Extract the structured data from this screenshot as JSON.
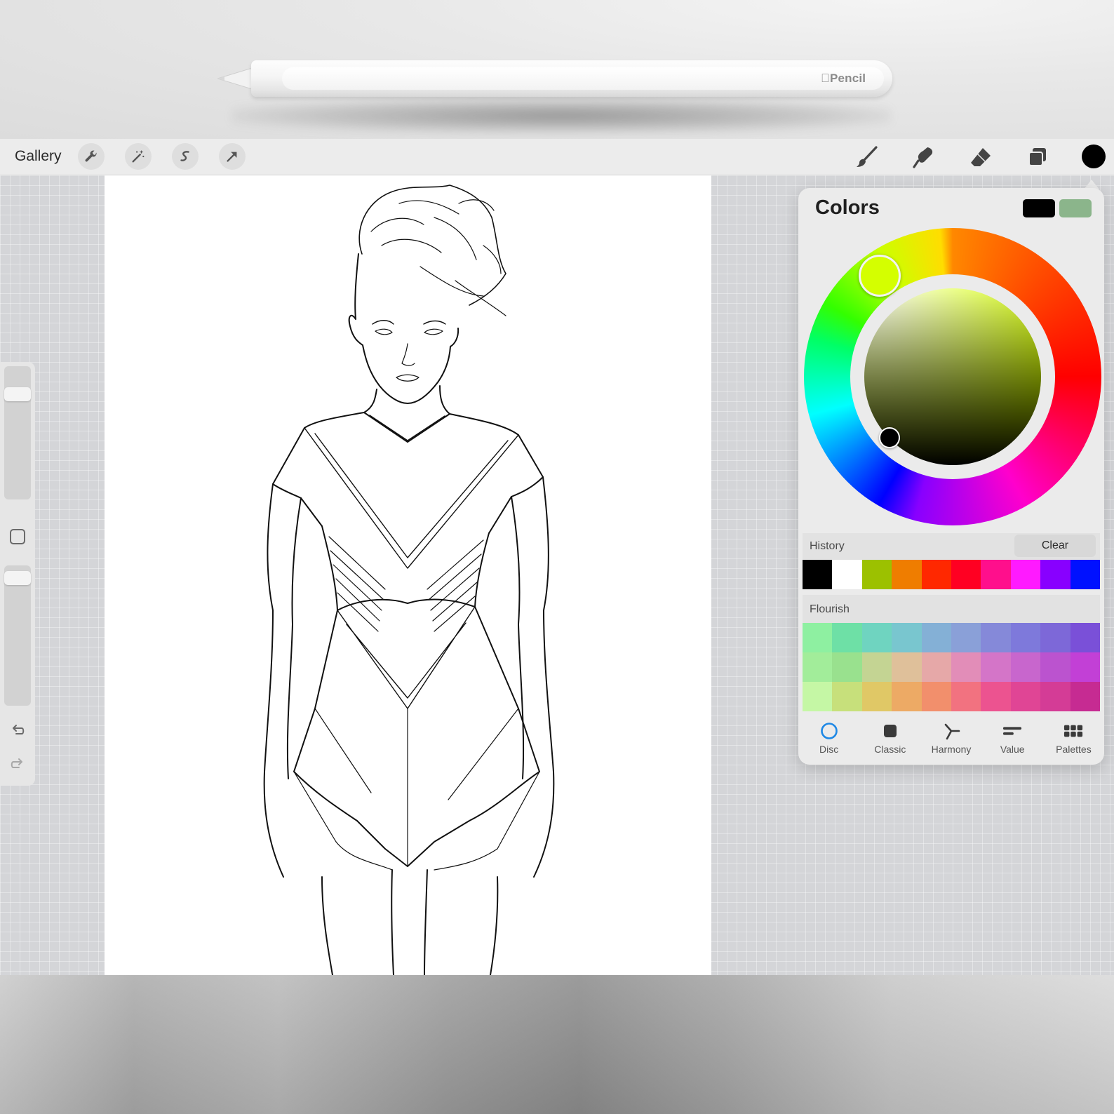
{
  "photo": {
    "pencil_brand": "Pencil"
  },
  "toolbar": {
    "gallery_label": "Gallery",
    "left_tools": [
      "wrench-icon",
      "magic-wand-icon",
      "selection-icon",
      "transform-arrow-icon"
    ],
    "right_tools": [
      "brush-icon",
      "smudge-icon",
      "eraser-icon",
      "layers-icon"
    ],
    "active_color": "#000000"
  },
  "sidebar": {
    "brush_size_level": 0.05,
    "opacity_level": 0.05,
    "modify_icon": "square-icon",
    "undo_icon": "undo-icon",
    "redo_icon": "redo-icon"
  },
  "colors_panel": {
    "title": "Colors",
    "primary_color": "#000000",
    "secondary_color": "#8bb58b",
    "hue_selected": "#d4ff00",
    "history": {
      "label": "History",
      "clear_label": "Clear",
      "swatches": [
        "#000000",
        "#ffffff",
        "#9cc100",
        "#ef7d00",
        "#ff2800",
        "#ff0022",
        "#ff0f8c",
        "#ff1aff",
        "#8800ff",
        "#0011ff"
      ]
    },
    "flourish": {
      "label": "Flourish",
      "rows": [
        [
          "#8ef0a1",
          "#6ee0a6",
          "#6fd4c0",
          "#79c6cf",
          "#84b0d6",
          "#8aa0d8",
          "#8589d9",
          "#7e79db",
          "#7d68d8",
          "#7a50d8"
        ],
        [
          "#a2ed9a",
          "#99e18e",
          "#c4d493",
          "#dfc09a",
          "#e6a8a8",
          "#e28db8",
          "#d475c8",
          "#c866cd",
          "#bb53cf",
          "#c240d6"
        ],
        [
          "#c5f7a5",
          "#c7e07b",
          "#e0c866",
          "#edaa65",
          "#f28f6c",
          "#f27280",
          "#ec5390",
          "#e04595",
          "#d43c96",
          "#c62b92"
        ]
      ]
    },
    "tabs": [
      {
        "label": "Disc",
        "icon": "disc-icon"
      },
      {
        "label": "Classic",
        "icon": "classic-square-icon"
      },
      {
        "label": "Harmony",
        "icon": "harmony-icon"
      },
      {
        "label": "Value",
        "icon": "value-bars-icon"
      },
      {
        "label": "Palettes",
        "icon": "palettes-grid-icon"
      }
    ],
    "active_tab": "Disc"
  }
}
